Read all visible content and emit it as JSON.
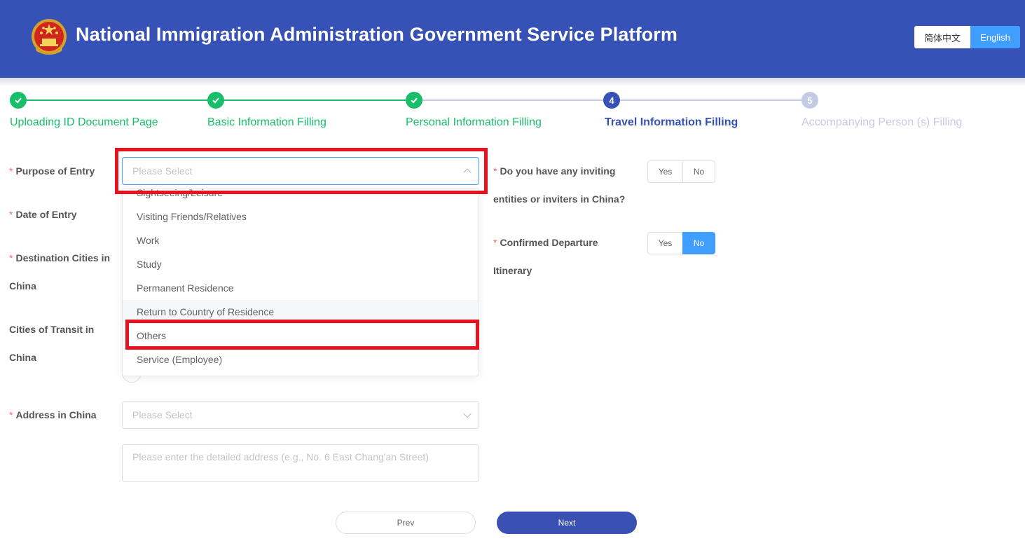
{
  "header": {
    "title": "National Immigration Administration Government Service Platform",
    "emblem_icon": "national-emblem-icon",
    "lang_cn": "简体中文",
    "lang_en": "English",
    "active_lang": "English"
  },
  "colors": {
    "header_bg": "#3652b6",
    "step_done": "#19be6b",
    "step_active": "#3652b6",
    "step_pending": "#c5cbe3",
    "accent": "#409eff",
    "required": "#f56c6c",
    "highlight": "#e5131d"
  },
  "steps": [
    {
      "label": "Uploading ID Document Page",
      "state": "done",
      "icon": "check-icon"
    },
    {
      "label": "Basic Information Filling",
      "state": "done",
      "icon": "check-icon"
    },
    {
      "label": "Personal Information Filling",
      "state": "done",
      "icon": "check-icon"
    },
    {
      "label": "Travel Information Filling",
      "state": "active",
      "number": "4"
    },
    {
      "label": "Accompanying Person (s) Filling",
      "state": "pending",
      "number": "5"
    }
  ],
  "form": {
    "required_mark": "*",
    "purpose": {
      "label": "Purpose of Entry",
      "placeholder": "Please Select"
    },
    "date": {
      "label": "Date of Entry"
    },
    "destination": {
      "label_line1": "Destination Cities in",
      "label_line2": "China"
    },
    "transit": {
      "label_line1": "Cities of Transit in",
      "label_line2": "China"
    },
    "address": {
      "label": "Address in China",
      "placeholder": "Please Select",
      "detail_placeholder": "Please enter the detailed address (e.g., No. 6 East Chang'an Street)"
    },
    "inviting": {
      "label_line1": "Do you have any inviting",
      "label_line2": "entities or inviters in China?",
      "yes": "Yes",
      "no": "No",
      "selected": ""
    },
    "departure": {
      "label_line1": "Confirmed Departure",
      "label_line2": "Itinerary",
      "yes": "Yes",
      "no": "No",
      "selected": "No"
    }
  },
  "dropdown": {
    "options": [
      "Sightseeing/Leisure",
      "Visiting Friends/Relatives",
      "Work",
      "Study",
      "Permanent Residence",
      "Return to Country of Residence",
      "Others",
      "Service (Employee)"
    ],
    "hovered": "Return to Country of Residence",
    "highlighted": "Others"
  },
  "buttons": {
    "prev": "Prev",
    "next": "Next"
  }
}
